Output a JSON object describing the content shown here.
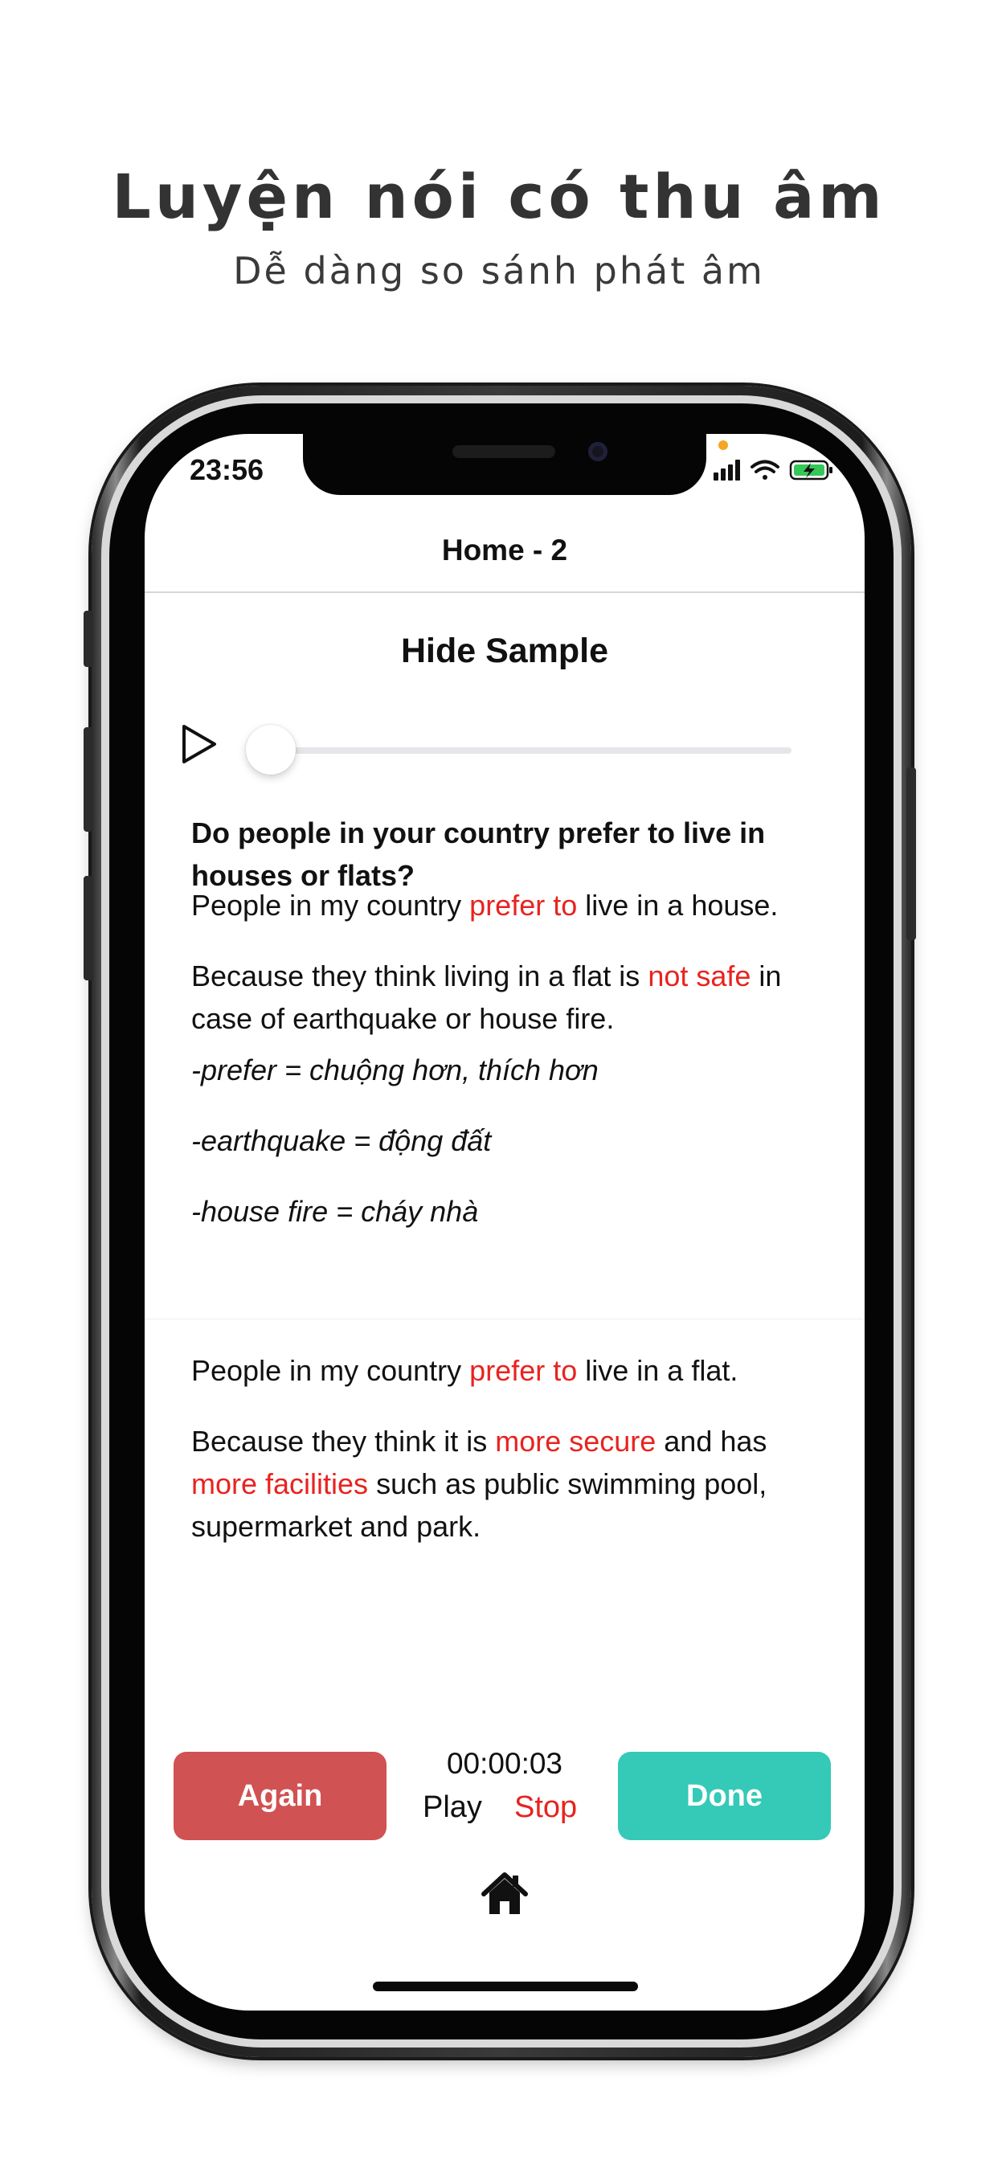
{
  "promo": {
    "title": "Luyện nói có thu âm",
    "subtitle": "Dễ dàng so sánh phát âm"
  },
  "status_bar": {
    "time": "23:56",
    "icons": [
      "cellular-signal-icon",
      "wifi-icon",
      "battery-charging-icon"
    ]
  },
  "nav": {
    "title": "Home - 2"
  },
  "sample": {
    "toggle_label": "Hide Sample",
    "progress": 0
  },
  "lesson": {
    "question": "Do people in your country prefer to live in houses or flats?",
    "answer1": {
      "sentence1": [
        "People in my country ",
        "prefer to",
        " live in a house."
      ],
      "sentence2": [
        "Because they think living in a flat is ",
        "not safe",
        " in case of earthquake or house fire."
      ]
    },
    "vocab": [
      "-prefer = chuộng hơn, thích hơn",
      "-earthquake = động đất",
      "-house fire = cháy nhà"
    ],
    "answer2": {
      "sentence1": [
        "People in my country ",
        "prefer to",
        " live in a flat."
      ],
      "sentence2": [
        "Because they think it is ",
        "more secure",
        " and has ",
        "more facilities",
        " such as public swimming pool, supermarket and park."
      ]
    }
  },
  "controls": {
    "again_label": "Again",
    "done_label": "Done",
    "timer": "00:00:03",
    "play_label": "Play",
    "stop_label": "Stop"
  },
  "colors": {
    "again": "#d15252",
    "done": "#35c9b7",
    "highlight": "#e8231f",
    "stop": "#e8231f"
  }
}
